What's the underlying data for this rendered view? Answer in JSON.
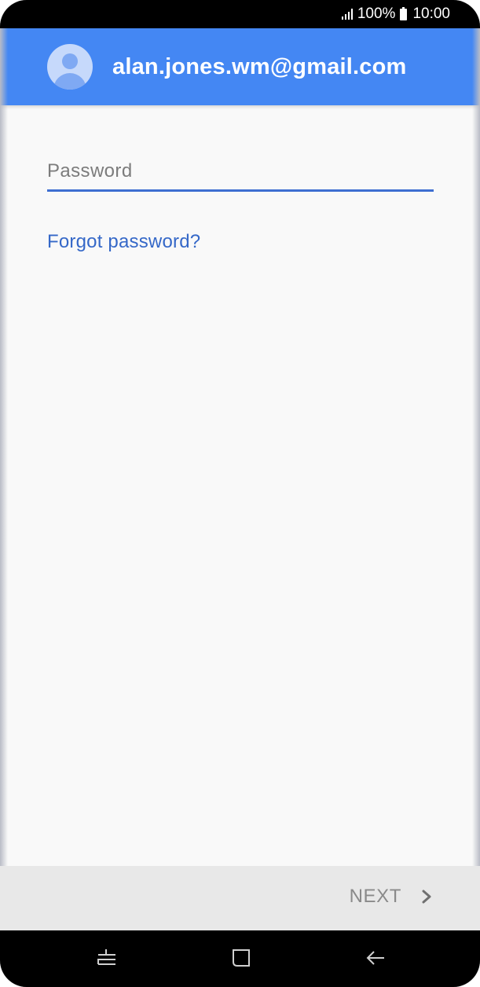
{
  "status_bar": {
    "battery": "100%",
    "time": "10:00",
    "icons": [
      "signal-icon",
      "battery-icon"
    ]
  },
  "header": {
    "account": "alan.jones.wm@gmail.com",
    "avatar_icon": "avatar-icon",
    "color": "#4487f3"
  },
  "form": {
    "password_placeholder": "Password",
    "password_value": "",
    "forgot_label": "Forgot password?",
    "accent": "#3e6ed1"
  },
  "footer": {
    "next_label": "NEXT",
    "next_icon": "chevron-right-icon"
  },
  "nav": {
    "icons": [
      "recent-apps-icon",
      "home-icon",
      "back-icon"
    ]
  }
}
